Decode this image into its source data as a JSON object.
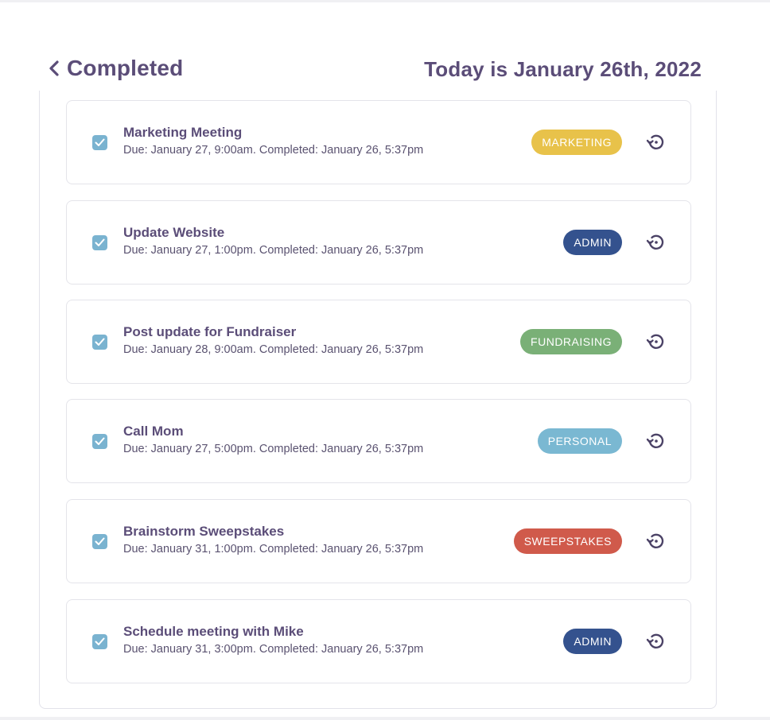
{
  "header": {
    "back_label": "Completed",
    "today": "Today is January 26th, 2022"
  },
  "tasks": [
    {
      "title": "Marketing Meeting",
      "meta": "Due: January 27, 9:00am. Completed: January 26, 5:37pm",
      "tag": "MARKETING",
      "tag_color": "#e8c24a",
      "completed": true
    },
    {
      "title": "Update Website",
      "meta": "Due: January 27, 1:00pm. Completed: January 26, 5:37pm",
      "tag": "ADMIN",
      "tag_color": "#34528e",
      "completed": true
    },
    {
      "title": "Post update for Fundraiser",
      "meta": "Due: January 28, 9:00am. Completed: January 26, 5:37pm",
      "tag": "FUNDRAISING",
      "tag_color": "#7ab077",
      "completed": true
    },
    {
      "title": "Call Mom",
      "meta": "Due: January 27, 5:00pm. Completed: January 26, 5:37pm",
      "tag": "PERSONAL",
      "tag_color": "#7ab8d2",
      "completed": true
    },
    {
      "title": "Brainstorm Sweepstakes",
      "meta": "Due: January 31, 1:00pm. Completed: January 26, 5:37pm",
      "tag": "SWEEPSTAKES",
      "tag_color": "#d05a4b",
      "completed": true
    },
    {
      "title": "Schedule meeting with Mike",
      "meta": "Due: January 31, 3:00pm. Completed: January 26, 5:37pm",
      "tag": "ADMIN",
      "tag_color": "#34528e",
      "completed": true
    }
  ],
  "icons": {
    "back": "chevron-left-icon",
    "checkbox": "check-icon",
    "restore": "restore-icon"
  }
}
